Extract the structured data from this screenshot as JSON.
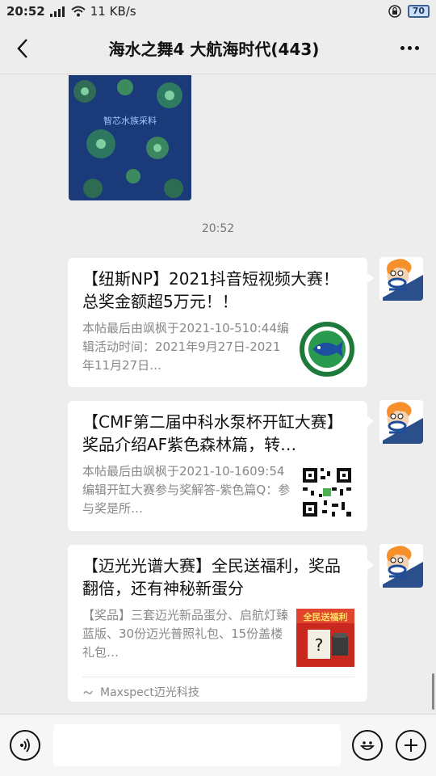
{
  "status_bar": {
    "time": "20:52",
    "network": "4G",
    "speed": "11 KB/s",
    "battery": "70"
  },
  "header": {
    "title": "海水之舞4 大航海时代(443)"
  },
  "chat": {
    "image_caption": "智芯水族采料",
    "timestamp": "20:52",
    "messages": [
      {
        "title": "【纽斯NP】2021抖音短视频大赛！ 总奖金额超5万元！！",
        "desc": "本帖最后由飒枫于2021-10-510:44编辑活动时间：2021年9月27日-2021年11月27日…"
      },
      {
        "title": "【CMF第二届中科水泵杯开缸大赛】奖品介绍AF紫色森林篇，转…",
        "desc": "本帖最后由飒枫于2021-10-1609:54编辑开缸大赛参与奖解答-紫色篇Q：参与奖是所…"
      },
      {
        "title": "【迈光光谱大赛】全民送福利，奖品翻倍，还有神秘新蛋分",
        "desc": "【奖品】三套迈光新品蛋分、启航灯臻蓝版、30份迈光普照礼包、15份盖楼礼包…",
        "thumb_text": "全民送福利",
        "source": "Maxspect迈光科技"
      }
    ]
  },
  "input_bar": {
    "placeholder": ""
  },
  "colors": {
    "background": "#ededed",
    "card": "#ffffff",
    "muted_text": "#888888"
  }
}
